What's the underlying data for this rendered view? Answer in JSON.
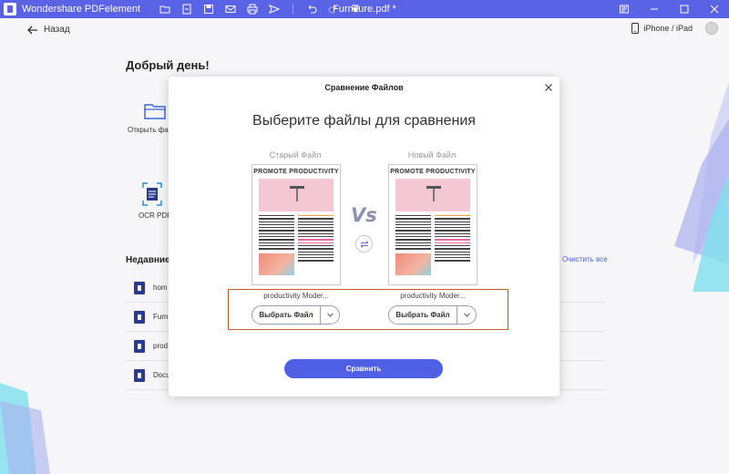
{
  "titlebar": {
    "app_name": "Wondershare PDFelement",
    "document_name": "Furniture.pdf *",
    "bg": "#5a62e6"
  },
  "topbar": {
    "back_label": "Назад",
    "device_label": "iPhone / iPad"
  },
  "home": {
    "greeting": "Добрый день!",
    "tiles": [
      {
        "label": "Открыть фа",
        "icon": "folder-icon"
      },
      {
        "label": "OCR PDF",
        "icon": "ocr-icon"
      }
    ],
    "recent_title": "Недавние",
    "clear_all": "Очистить все",
    "recent_files": [
      {
        "name": "hom"
      },
      {
        "name": "Furn"
      },
      {
        "name": "prod"
      },
      {
        "name": "Docu"
      }
    ]
  },
  "modal": {
    "title": "Сравнение Файлов",
    "heading": "Выберите файлы для сравнения",
    "vs_label": "Vs",
    "old": {
      "label": "Старый Файл",
      "doc_title": "PROMOTE PRODUCTIVITY",
      "file_name": "productivity Moder...",
      "pick_label": "Выбрать Файл"
    },
    "new": {
      "label": "Новый Файл",
      "doc_title": "PROMOTE PRODUCTIVITY",
      "file_name": "productivity Moder...",
      "pick_label": "Выбрать Файл"
    },
    "compare_label": "Сравнить",
    "accent": "#5060e4",
    "highlight_border": "#c75a1d"
  }
}
